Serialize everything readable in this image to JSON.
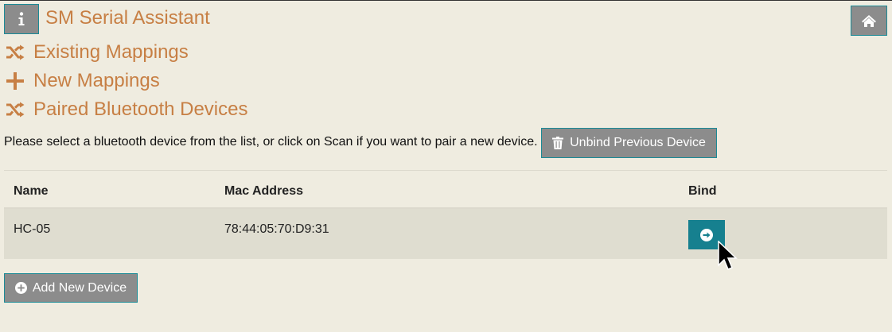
{
  "header": {
    "title": "SM Serial Assistant",
    "info_icon": "info-icon",
    "home_icon": "home-icon"
  },
  "nav": [
    {
      "label": "Existing Mappings",
      "icon": "shuffle-icon"
    },
    {
      "label": "New Mappings",
      "icon": "plus-icon"
    },
    {
      "label": "Paired Bluetooth Devices",
      "icon": "shuffle-icon"
    }
  ],
  "instruction": "Please select a bluetooth device from the list, or click on Scan if you want to pair a new device.",
  "unbind_button": {
    "label": "Unbind Previous Device",
    "icon": "trash-icon"
  },
  "table": {
    "headers": [
      "Name",
      "Mac Address",
      "Bind"
    ],
    "rows": [
      {
        "name": "HC-05",
        "mac": "78:44:05:70:D9:31",
        "bind_icon": "arrow-circle-right-icon"
      }
    ]
  },
  "add_button": {
    "label": "Add New Device",
    "icon": "plus-circle-icon"
  },
  "colors": {
    "background": "#efece0",
    "accent_text": "#c77f44",
    "button_gray": "#8c8c8c",
    "button_teal": "#16808f",
    "row_highlight": "#dfddd0"
  }
}
